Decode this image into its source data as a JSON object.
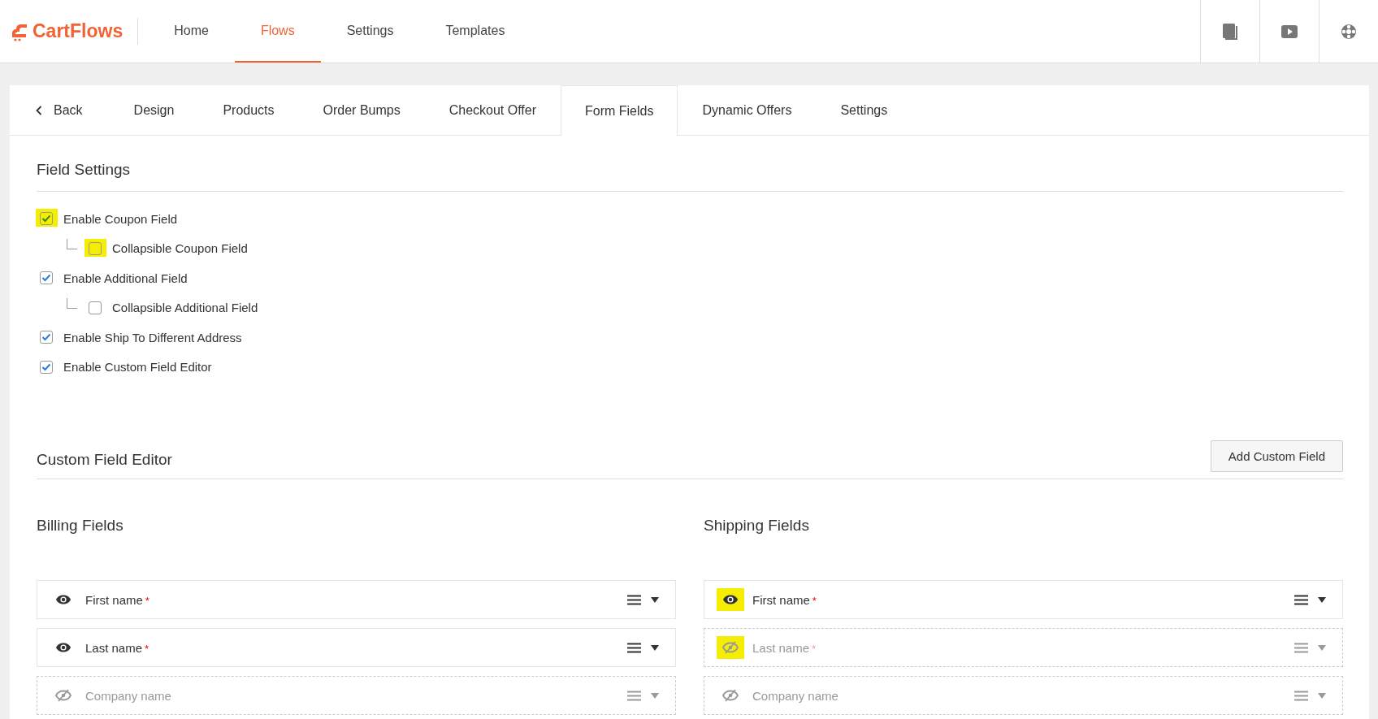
{
  "header": {
    "logo": "CartFlows",
    "nav": [
      {
        "label": "Home",
        "selected": false
      },
      {
        "label": "Flows",
        "selected": true
      },
      {
        "label": "Settings",
        "selected": false
      },
      {
        "label": "Templates",
        "selected": false
      }
    ]
  },
  "tabs": [
    {
      "label": "Back",
      "kind": "back",
      "selected": false
    },
    {
      "label": "Design",
      "kind": "tab",
      "selected": false
    },
    {
      "label": "Products",
      "kind": "tab",
      "selected": false
    },
    {
      "label": "Order Bumps",
      "kind": "tab",
      "selected": false
    },
    {
      "label": "Checkout Offer",
      "kind": "tab",
      "selected": false
    },
    {
      "label": "Form Fields",
      "kind": "tab",
      "selected": true
    },
    {
      "label": "Dynamic Offers",
      "kind": "tab",
      "selected": false
    },
    {
      "label": "Settings",
      "kind": "tab",
      "selected": false
    }
  ],
  "field_settings": {
    "title": "Field Settings",
    "options": [
      {
        "label": "Enable Coupon Field",
        "checked": true,
        "highlighted": true,
        "children": [
          {
            "label": "Collapsible Coupon Field",
            "checked": false,
            "highlighted": true
          }
        ]
      },
      {
        "label": "Enable Additional Field",
        "checked": true,
        "highlighted": false,
        "children": [
          {
            "label": "Collapsible Additional Field",
            "checked": false,
            "highlighted": false
          }
        ]
      },
      {
        "label": "Enable Ship To Different Address",
        "checked": true,
        "highlighted": false
      },
      {
        "label": "Enable Custom Field Editor",
        "checked": true,
        "highlighted": false
      }
    ]
  },
  "custom_field_editor": {
    "title": "Custom Field Editor",
    "button": "Add Custom Field",
    "columns": [
      {
        "title": "Billing Fields",
        "fields": [
          {
            "label": "First name",
            "required_mark": "*",
            "visible": true,
            "highlighted": false
          },
          {
            "label": "Last name",
            "required_mark": "*",
            "visible": true,
            "highlighted": false
          },
          {
            "label": "Company name",
            "visible": false,
            "highlighted": false
          }
        ]
      },
      {
        "title": "Shipping Fields",
        "fields": [
          {
            "label": "First name",
            "required_mark": "*",
            "visible": true,
            "highlighted": true
          },
          {
            "label": "Last name",
            "required_mark": "*",
            "visible": false,
            "highlighted": true
          },
          {
            "label": "Company name",
            "visible": false,
            "highlighted": false
          }
        ]
      }
    ]
  }
}
